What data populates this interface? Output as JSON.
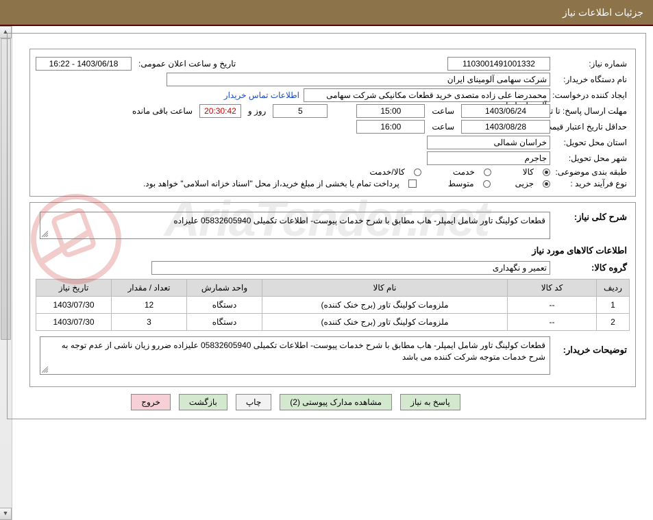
{
  "header": {
    "title": "جزئیات اطلاعات نیاز"
  },
  "watermark": "AriaTender.net",
  "labels": {
    "reqNumber": "شماره نیاز:",
    "announceDate": "تاریخ و ساعت اعلان عمومی:",
    "buyerOrg": "نام دستگاه خریدار:",
    "requester": "ایجاد کننده درخواست:",
    "contactLink": "اطلاعات تماس خریدار",
    "deadline": "مهلت ارسال پاسخ: تا تاریخ:",
    "hour": "ساعت",
    "time": "ساعت",
    "daysAnd": "روز و",
    "remaining": "ساعت باقی مانده",
    "validityMin": "حداقل تاریخ اعتبار قیمت: تا تاریخ:",
    "province": "استان محل تحویل:",
    "city": "شهر محل تحویل:",
    "category": "طبقه بندی موضوعی:",
    "catGoods": "کالا",
    "catService": "خدمت",
    "catBoth": "کالا/خدمت",
    "procType": "نوع فرآیند خرید :",
    "procPartial": "جزیی",
    "procMedium": "متوسط",
    "treasuryNote": "پرداخت تمام یا بخشی از مبلغ خرید،از محل \"اسناد خزانه اسلامی\" خواهد بود.",
    "generalDesc": "شرح کلی نیاز:",
    "goodsInfoTitle": "اطلاعات کالاهای مورد نیاز",
    "goodsGroup": "گروه کالا:",
    "buyerNotes": "توضیحات خریدار:"
  },
  "values": {
    "reqNumber": "1103001491001332",
    "announceDate": "1403/06/18 - 16:22",
    "buyerOrg": "شرکت سهامی آلومینای ایران",
    "requester": "محمدرضا علی زاده متصدی خرید قطعات مکانیکی شرکت سهامی آلومینای ایران",
    "deadlineDate": "1403/06/24",
    "deadlineHour": "15:00",
    "daysLeft": "5",
    "countdown": "20:30:42",
    "validityDate": "1403/08/28",
    "validityHour": "16:00",
    "province": "خراسان شمالی",
    "city": "جاجرم",
    "generalDesc": "قطعات کولینگ تاور شامل ایمپلر- هاب مطابق با شرح خدمات پیوست- اطلاعات تکمیلی 05832605940 علیزاده",
    "goodsGroup": "تعمیر و نگهداری",
    "buyerNotes": "قطعات کولینگ تاور شامل ایمپلر- هاب مطابق با شرح خدمات پیوست- اطلاعات تکمیلی 05832605940 علیزاده ضررو زیان ناشی از عدم توجه به شرح خدمات متوجه شرکت کننده می باشد"
  },
  "table": {
    "headers": [
      "ردیف",
      "کد کالا",
      "نام کالا",
      "واحد شمارش",
      "تعداد / مقدار",
      "تاریخ نیاز"
    ],
    "rows": [
      {
        "n": "1",
        "code": "--",
        "name": "ملزومات کولینگ تاور (برج خنک کننده)",
        "unit": "دستگاه",
        "qty": "12",
        "date": "1403/07/30"
      },
      {
        "n": "2",
        "code": "--",
        "name": "ملزومات کولینگ تاور (برج خنک کننده)",
        "unit": "دستگاه",
        "qty": "3",
        "date": "1403/07/30"
      }
    ]
  },
  "buttons": {
    "reply": "پاسخ به نیاز",
    "viewAttach": "مشاهده مدارک پیوستی (2)",
    "print": "چاپ",
    "back": "بازگشت",
    "exit": "خروج"
  }
}
